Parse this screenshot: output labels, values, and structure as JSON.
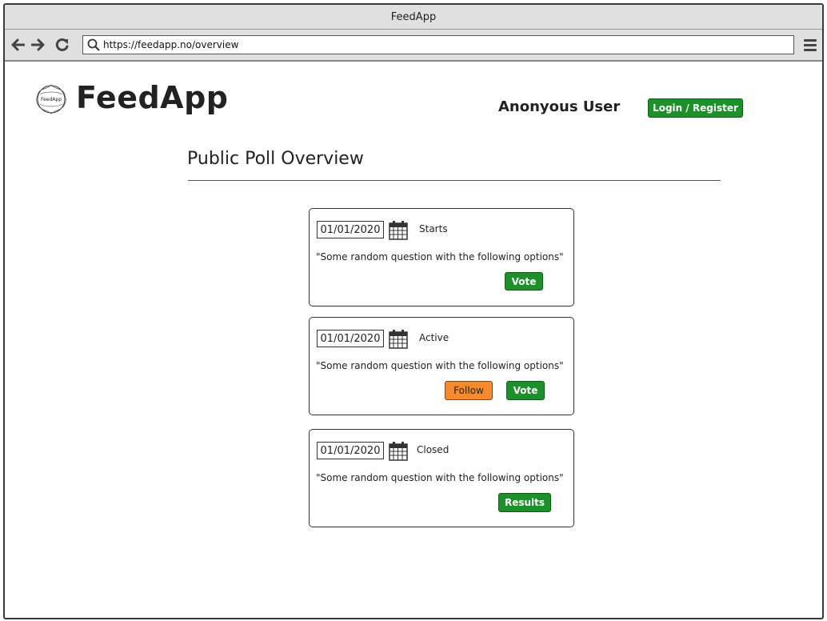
{
  "window": {
    "title": "FeedApp"
  },
  "browser": {
    "url": "https://feedapp.no/overview"
  },
  "header": {
    "brand": "FeedApp",
    "logo_text": "FeedApp",
    "user_name": "Anonyous User",
    "login_label": "Login / Register"
  },
  "page": {
    "title": "Public Poll Overview"
  },
  "polls": [
    {
      "date": "01/01/2020",
      "status": "Starts",
      "question": "\"Some random question with the following options\"",
      "vote_label": "Vote"
    },
    {
      "date": "01/01/2020",
      "status": "Active",
      "question": "\"Some random question with the following options\"",
      "follow_label": "Follow",
      "vote_label": "Vote"
    },
    {
      "date": "01/01/2020",
      "status": "Closed",
      "question": "\"Some random question with the following options\"",
      "results_label": "Results"
    }
  ],
  "colors": {
    "green": "#1d8f2b",
    "orange": "#f58a2e",
    "chrome": "#e0e0e0"
  },
  "icons": [
    "back-arrow-icon",
    "forward-arrow-icon",
    "reload-icon",
    "search-icon",
    "menu-icon",
    "calendar-icon",
    "logo"
  ]
}
